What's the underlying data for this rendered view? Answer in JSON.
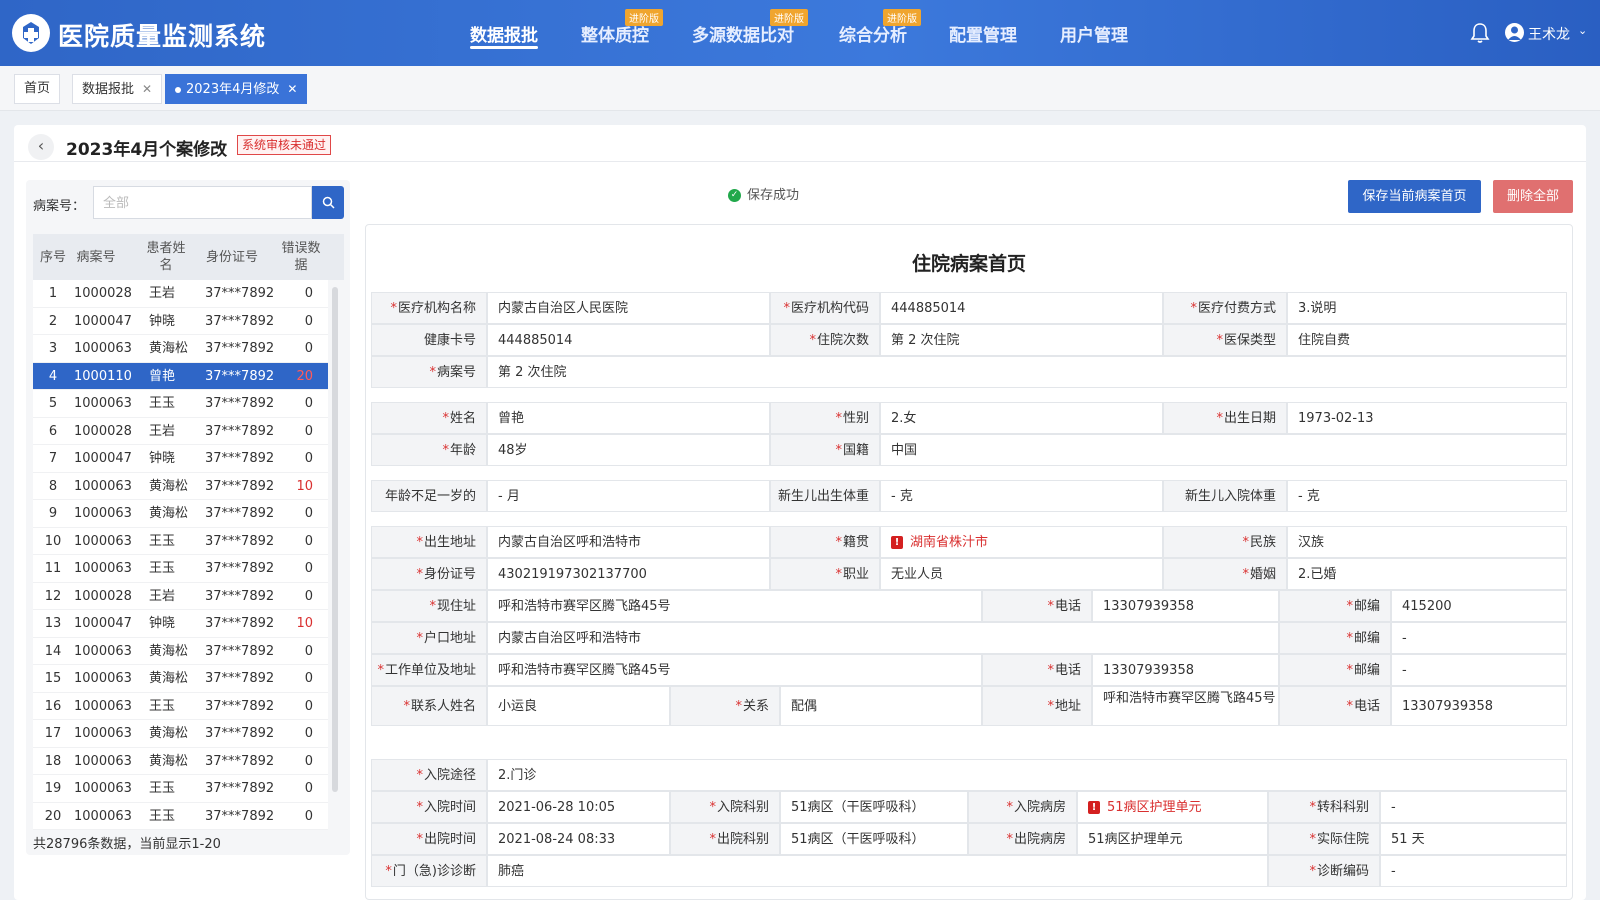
{
  "app": {
    "title": "医院质量监测系统"
  },
  "nav": [
    {
      "label": "数据报批",
      "active": true,
      "tag": ""
    },
    {
      "label": "整体质控",
      "active": false,
      "tag": "进阶版"
    },
    {
      "label": "多源数据比对",
      "active": false,
      "tag": "进阶版"
    },
    {
      "label": "综合分析",
      "active": false,
      "tag": "进阶版"
    },
    {
      "label": "配置管理",
      "active": false,
      "tag": ""
    },
    {
      "label": "用户管理",
      "active": false,
      "tag": ""
    }
  ],
  "user": {
    "name": "王术龙"
  },
  "tabs": [
    {
      "label": "首页",
      "closable": false,
      "active": false
    },
    {
      "label": "数据报批",
      "closable": true,
      "active": false
    },
    {
      "label": "2023年4月修改",
      "closable": true,
      "active": true
    }
  ],
  "page": {
    "title": "2023年4月个案修改",
    "status_badge": "系统审核未通过"
  },
  "search": {
    "label": "病案号：",
    "placeholder": "全部"
  },
  "table": {
    "headers": [
      "序号",
      "病案号",
      "患者姓名",
      "身份证号",
      "错误数据"
    ],
    "rows": [
      {
        "no": "1",
        "case": "1000028",
        "name": "王岩",
        "id": "37***7892",
        "err": "0"
      },
      {
        "no": "2",
        "case": "1000047",
        "name": "钟晓",
        "id": "37***7892",
        "err": "0"
      },
      {
        "no": "3",
        "case": "1000063",
        "name": "黄海松",
        "id": "37***7892",
        "err": "0"
      },
      {
        "no": "4",
        "case": "1000110",
        "name": "曾艳",
        "id": "37***7892",
        "err": "20"
      },
      {
        "no": "5",
        "case": "1000063",
        "name": "王玉",
        "id": "37***7892",
        "err": "0"
      },
      {
        "no": "6",
        "case": "1000028",
        "name": "王岩",
        "id": "37***7892",
        "err": "0"
      },
      {
        "no": "7",
        "case": "1000047",
        "name": "钟晓",
        "id": "37***7892",
        "err": "0"
      },
      {
        "no": "8",
        "case": "1000063",
        "name": "黄海松",
        "id": "37***7892",
        "err": "10"
      },
      {
        "no": "9",
        "case": "1000063",
        "name": "黄海松",
        "id": "37***7892",
        "err": "0"
      },
      {
        "no": "10",
        "case": "1000063",
        "name": "王玉",
        "id": "37***7892",
        "err": "0"
      },
      {
        "no": "11",
        "case": "1000063",
        "name": "王玉",
        "id": "37***7892",
        "err": "0"
      },
      {
        "no": "12",
        "case": "1000028",
        "name": "王岩",
        "id": "37***7892",
        "err": "0"
      },
      {
        "no": "13",
        "case": "1000047",
        "name": "钟晓",
        "id": "37***7892",
        "err": "10"
      },
      {
        "no": "14",
        "case": "1000063",
        "name": "黄海松",
        "id": "37***7892",
        "err": "0"
      },
      {
        "no": "15",
        "case": "1000063",
        "name": "黄海松",
        "id": "37***7892",
        "err": "0"
      },
      {
        "no": "16",
        "case": "1000063",
        "name": "王玉",
        "id": "37***7892",
        "err": "0"
      },
      {
        "no": "17",
        "case": "1000063",
        "name": "黄海松",
        "id": "37***7892",
        "err": "0"
      },
      {
        "no": "18",
        "case": "1000063",
        "name": "黄海松",
        "id": "37***7892",
        "err": "0"
      },
      {
        "no": "19",
        "case": "1000063",
        "name": "王玉",
        "id": "37***7892",
        "err": "0"
      },
      {
        "no": "20",
        "case": "1000063",
        "name": "王玉",
        "id": "37***7892",
        "err": "0"
      }
    ],
    "selected_row": 4,
    "footer": "共28796条数据，当前显示1-20"
  },
  "actions": {
    "save_status": "保存成功",
    "save_button": "保存当前病案首页",
    "delete_button": "删除全部"
  },
  "form": {
    "title": "住院病案首页",
    "fields": [
      {
        "key": "inst_name",
        "label": "医疗机构名称",
        "req": true,
        "value": "内蒙古自治区人民医院"
      },
      {
        "key": "inst_code",
        "label": "医疗机构代码",
        "req": true,
        "value": "444885014"
      },
      {
        "key": "pay",
        "label": "医疗付费方式",
        "req": true,
        "value": "3.说明"
      },
      {
        "key": "health_card",
        "label": "健康卡号",
        "req": false,
        "value": "444885014"
      },
      {
        "key": "admit_times",
        "label": "住院次数",
        "req": true,
        "value": "第   2   次住院"
      },
      {
        "key": "insurance",
        "label": "医保类型",
        "req": true,
        "value": "住院自费"
      },
      {
        "key": "case_no",
        "label": "病案号",
        "req": true,
        "value": "第   2   次住院"
      },
      {
        "key": "name",
        "label": "姓名",
        "req": true,
        "value": "曾艳"
      },
      {
        "key": "sex",
        "label": "性别",
        "req": true,
        "value": "2.女"
      },
      {
        "key": "birth",
        "label": "出生日期",
        "req": true,
        "value": "1973-02-13"
      },
      {
        "key": "age",
        "label": "年龄",
        "req": true,
        "value": "48岁"
      },
      {
        "key": "nation",
        "label": "国籍",
        "req": true,
        "value": "中国"
      },
      {
        "key": "infant_age",
        "label": "年龄不足一岁的",
        "req": false,
        "value": "-  月"
      },
      {
        "key": "birth_weight",
        "label": "新生儿出生体重",
        "req": false,
        "value": "-  克"
      },
      {
        "key": "admit_weight",
        "label": "新生儿入院体重",
        "req": false,
        "value": "-  克"
      },
      {
        "key": "birth_addr",
        "label": "出生地址",
        "req": true,
        "value": "内蒙古自治区呼和浩特市"
      },
      {
        "key": "native",
        "label": "籍贯",
        "req": true,
        "value": "湖南省株汁市",
        "error": true
      },
      {
        "key": "ethnic",
        "label": "民族",
        "req": true,
        "value": "汉族"
      },
      {
        "key": "idno",
        "label": "身份证号",
        "req": true,
        "value": "430219197302137700"
      },
      {
        "key": "job",
        "label": "职业",
        "req": true,
        "value": "无业人员"
      },
      {
        "key": "marriage",
        "label": "婚姻",
        "req": true,
        "value": "2.已婚"
      },
      {
        "key": "cur_addr",
        "label": "现住址",
        "req": true,
        "value": "呼和浩特市赛罕区腾飞路45号"
      },
      {
        "key": "cur_tel",
        "label": "电话",
        "req": true,
        "value": "13307939358"
      },
      {
        "key": "cur_zip",
        "label": "邮编",
        "req": true,
        "value": "415200"
      },
      {
        "key": "reg_addr",
        "label": "户口地址",
        "req": true,
        "value": "内蒙古自治区呼和浩特市"
      },
      {
        "key": "reg_zip",
        "label": "邮编",
        "req": true,
        "value": "-"
      },
      {
        "key": "work_addr",
        "label": "工作单位及地址",
        "req": true,
        "value": "呼和浩特市赛罕区腾飞路45号"
      },
      {
        "key": "work_tel",
        "label": "电话",
        "req": true,
        "value": "13307939358"
      },
      {
        "key": "work_zip",
        "label": "邮编",
        "req": true,
        "value": "-"
      },
      {
        "key": "contact",
        "label": "联系人姓名",
        "req": true,
        "value": "小运良"
      },
      {
        "key": "relation",
        "label": "关系",
        "req": true,
        "value": "配偶"
      },
      {
        "key": "contact_addr",
        "label": "地址",
        "req": true,
        "value": "呼和浩特市赛罕区腾飞路45号"
      },
      {
        "key": "contact_tel",
        "label": "电话",
        "req": true,
        "value": "13307939358"
      },
      {
        "key": "admit_route",
        "label": "入院途径",
        "req": true,
        "value": "2.门诊"
      },
      {
        "key": "admit_time",
        "label": "入院时间",
        "req": true,
        "value": "2021-06-28 10:05"
      },
      {
        "key": "admit_dept",
        "label": "入院科别",
        "req": true,
        "value": "51病区（干医呼吸科）"
      },
      {
        "key": "admit_ward",
        "label": "入院病房",
        "req": true,
        "value": "51病区护理单元",
        "error": true
      },
      {
        "key": "transfer",
        "label": "转科科别",
        "req": true,
        "value": "-"
      },
      {
        "key": "dis_time",
        "label": "出院时间",
        "req": true,
        "value": "2021-08-24 08:33"
      },
      {
        "key": "dis_dept",
        "label": "出院科别",
        "req": true,
        "value": "51病区（干医呼吸科）"
      },
      {
        "key": "dis_ward",
        "label": "出院病房",
        "req": true,
        "value": "51病区护理单元"
      },
      {
        "key": "stay",
        "label": "实际住院",
        "req": true,
        "value": "51 天"
      },
      {
        "key": "diag",
        "label": "门（急)诊诊断",
        "req": true,
        "value": "肺癌"
      },
      {
        "key": "diag_code",
        "label": "诊断编码",
        "req": true,
        "value": "-"
      }
    ]
  },
  "colors": {
    "primary": "#2f66c7",
    "danger": "#d93030",
    "delete": "#e07070",
    "success": "#21a84b",
    "tag": "#f0a52e"
  }
}
